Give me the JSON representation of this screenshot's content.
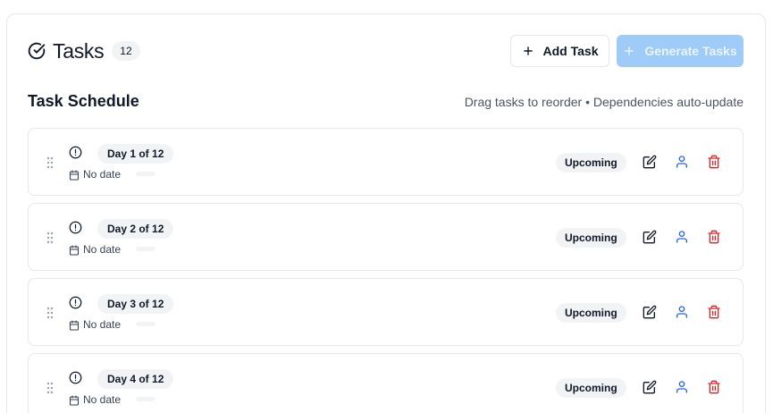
{
  "header": {
    "title": "Tasks",
    "count": "12",
    "add_label": "Add Task",
    "generate_label": "Generate Tasks"
  },
  "schedule": {
    "title": "Task Schedule",
    "hint": "Drag tasks to reorder • Dependencies auto-update"
  },
  "tasks": [
    {
      "day": "Day 1 of 12",
      "date": "No date",
      "status": "Upcoming"
    },
    {
      "day": "Day 2 of 12",
      "date": "No date",
      "status": "Upcoming"
    },
    {
      "day": "Day 3 of 12",
      "date": "No date",
      "status": "Upcoming"
    },
    {
      "day": "Day 4 of 12",
      "date": "No date",
      "status": "Upcoming"
    }
  ],
  "colors": {
    "accent": "#9ecbf7",
    "user_icon": "#2563eb",
    "delete_icon": "#dc2626"
  },
  "icons": {
    "title": "circle-check-icon",
    "add": "plus-icon",
    "generate": "plus-icon",
    "drag": "grip-vertical-icon",
    "alert": "alert-circle-icon",
    "calendar": "calendar-icon",
    "edit": "edit-icon",
    "assign": "user-icon",
    "delete": "trash-icon"
  }
}
